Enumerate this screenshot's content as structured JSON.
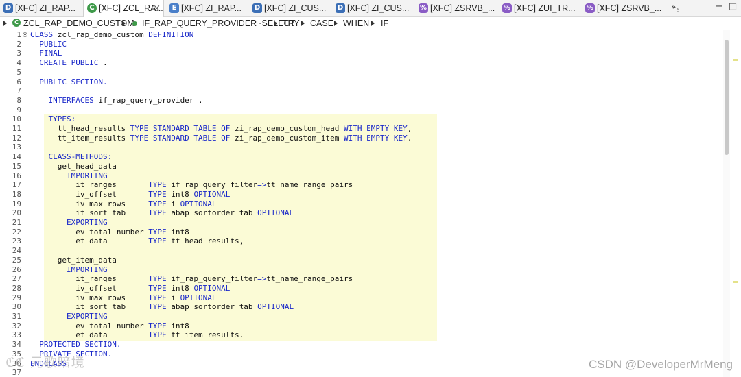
{
  "tabs": [
    {
      "icon": "data-definition-icon",
      "glyph": "D",
      "cls": "d",
      "label": "[XFC] ZI_RAP...",
      "active": false
    },
    {
      "icon": "class-icon",
      "glyph": "C",
      "cls": "c",
      "label": "[XFC] ZCL_RA...",
      "active": true
    },
    {
      "icon": "behavior-definition-icon",
      "glyph": "E",
      "cls": "e",
      "label": "[XFC] ZI_RAP...",
      "active": false
    },
    {
      "icon": "data-definition-icon",
      "glyph": "D",
      "cls": "d",
      "label": "[XFC] ZI_CUS...",
      "active": false
    },
    {
      "icon": "data-definition-icon",
      "glyph": "D",
      "cls": "d",
      "label": "[XFC] ZI_CUS...",
      "active": false
    },
    {
      "icon": "service-binding-icon",
      "glyph": "%",
      "cls": "v",
      "label": "[XFC] ZSRVB_...",
      "active": false
    },
    {
      "icon": "service-binding-icon",
      "glyph": "%",
      "cls": "v",
      "label": "[XFC] ZUI_TR...",
      "active": false
    },
    {
      "icon": "service-binding-icon",
      "glyph": "%",
      "cls": "v",
      "label": "[XFC] ZSRVB_...",
      "active": false
    }
  ],
  "tabs_overflow": {
    "symbol": "»",
    "count": "6"
  },
  "breadcrumb": {
    "class_name": "ZCL_RAP_DEMO_CUSTOM",
    "method": "IF_RAP_QUERY_PROVIDER~SELECT",
    "items": [
      "TRY",
      "CASE",
      "WHEN",
      "IF"
    ]
  },
  "code_lines": [
    [
      [
        "kw",
        "CLASS"
      ],
      [
        "t",
        " zcl_rap_demo_custom "
      ],
      [
        "kw",
        "DEFINITION"
      ]
    ],
    [
      [
        "t",
        "  "
      ],
      [
        "kw",
        "PUBLIC"
      ]
    ],
    [
      [
        "t",
        "  "
      ],
      [
        "kw",
        "FINAL"
      ]
    ],
    [
      [
        "t",
        "  "
      ],
      [
        "kw",
        "CREATE PUBLIC"
      ],
      [
        "t",
        " ."
      ]
    ],
    [],
    [
      [
        "t",
        "  "
      ],
      [
        "kw",
        "PUBLIC SECTION."
      ]
    ],
    [],
    [
      [
        "t",
        "    "
      ],
      [
        "kw",
        "INTERFACES"
      ],
      [
        "t",
        " if_rap_query_provider ."
      ]
    ],
    [],
    [
      [
        "t",
        "    "
      ],
      [
        "kw",
        "TYPES:"
      ]
    ],
    [
      [
        "t",
        "      tt_head_results "
      ],
      [
        "kw",
        "TYPE STANDARD TABLE OF"
      ],
      [
        "t",
        " zi_rap_demo_custom_head "
      ],
      [
        "kw",
        "WITH EMPTY KEY"
      ],
      [
        "t",
        ","
      ]
    ],
    [
      [
        "t",
        "      tt_item_results "
      ],
      [
        "kw",
        "TYPE STANDARD TABLE OF"
      ],
      [
        "t",
        " zi_rap_demo_custom_item "
      ],
      [
        "kw",
        "WITH EMPTY KEY"
      ],
      [
        "t",
        "."
      ]
    ],
    [],
    [
      [
        "t",
        "    "
      ],
      [
        "kw",
        "CLASS-METHODS:"
      ]
    ],
    [
      [
        "t",
        "      get_head_data"
      ]
    ],
    [
      [
        "t",
        "        "
      ],
      [
        "kw",
        "IMPORTING"
      ]
    ],
    [
      [
        "t",
        "          it_ranges       "
      ],
      [
        "kw",
        "TYPE"
      ],
      [
        "t",
        " if_rap_query_filter"
      ],
      [
        "kw",
        "=>"
      ],
      [
        "t",
        "tt_name_range_pairs"
      ]
    ],
    [
      [
        "t",
        "          iv_offset       "
      ],
      [
        "kw",
        "TYPE"
      ],
      [
        "t",
        " int8 "
      ],
      [
        "kw",
        "OPTIONAL"
      ]
    ],
    [
      [
        "t",
        "          iv_max_rows     "
      ],
      [
        "kw",
        "TYPE"
      ],
      [
        "t",
        " i "
      ],
      [
        "kw",
        "OPTIONAL"
      ]
    ],
    [
      [
        "t",
        "          it_sort_tab     "
      ],
      [
        "kw",
        "TYPE"
      ],
      [
        "t",
        " abap_sortorder_tab "
      ],
      [
        "kw",
        "OPTIONAL"
      ]
    ],
    [
      [
        "t",
        "        "
      ],
      [
        "kw",
        "EXPORTING"
      ]
    ],
    [
      [
        "t",
        "          ev_total_number "
      ],
      [
        "kw",
        "TYPE"
      ],
      [
        "t",
        " int8"
      ]
    ],
    [
      [
        "t",
        "          et_data         "
      ],
      [
        "kw",
        "TYPE"
      ],
      [
        "t",
        " tt_head_results,"
      ]
    ],
    [],
    [
      [
        "t",
        "      get_item_data"
      ]
    ],
    [
      [
        "t",
        "        "
      ],
      [
        "kw",
        "IMPORTING"
      ]
    ],
    [
      [
        "t",
        "          it_ranges       "
      ],
      [
        "kw",
        "TYPE"
      ],
      [
        "t",
        " if_rap_query_filter"
      ],
      [
        "kw",
        "=>"
      ],
      [
        "t",
        "tt_name_range_pairs"
      ]
    ],
    [
      [
        "t",
        "          iv_offset       "
      ],
      [
        "kw",
        "TYPE"
      ],
      [
        "t",
        " int8 "
      ],
      [
        "kw",
        "OPTIONAL"
      ]
    ],
    [
      [
        "t",
        "          iv_max_rows     "
      ],
      [
        "kw",
        "TYPE"
      ],
      [
        "t",
        " i "
      ],
      [
        "kw",
        "OPTIONAL"
      ]
    ],
    [
      [
        "t",
        "          it_sort_tab     "
      ],
      [
        "kw",
        "TYPE"
      ],
      [
        "t",
        " abap_sortorder_tab "
      ],
      [
        "kw",
        "OPTIONAL"
      ]
    ],
    [
      [
        "t",
        "        "
      ],
      [
        "kw",
        "EXPORTING"
      ]
    ],
    [
      [
        "t",
        "          ev_total_number "
      ],
      [
        "kw",
        "TYPE"
      ],
      [
        "t",
        " int8"
      ]
    ],
    [
      [
        "t",
        "          et_data         "
      ],
      [
        "kw",
        "TYPE"
      ],
      [
        "t",
        " tt_item_results."
      ]
    ],
    [
      [
        "t",
        "  "
      ],
      [
        "kw",
        "PROTECTED SECTION."
      ]
    ],
    [
      [
        "t",
        "  "
      ],
      [
        "kw",
        "PRIVATE SECTION."
      ]
    ],
    [
      [
        "kw",
        "ENDCLASS"
      ],
      [
        "t",
        "."
      ]
    ],
    []
  ],
  "colors": {
    "keyword": "#1b29c9",
    "highlight": "#fbfbd6",
    "text": "#111111"
  },
  "watermarks": {
    "left": "ℭℭ 元歌暗境",
    "right": "CSDN @DeveloperMrMeng"
  }
}
